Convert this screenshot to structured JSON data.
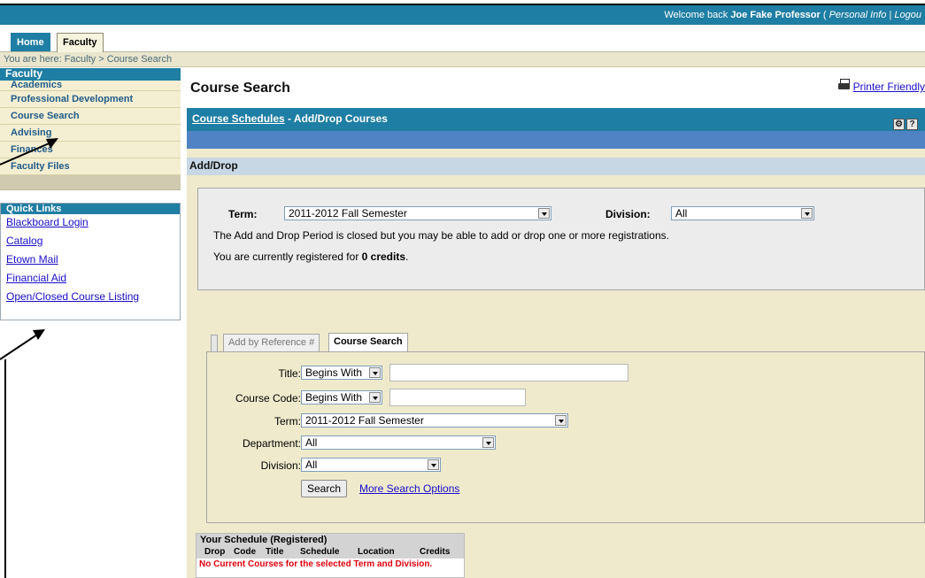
{
  "header": {
    "welcome_prefix": "Welcome back ",
    "user_name": "Joe Fake Professor",
    "paren_open": " ( ",
    "personal_info": "Personal Info",
    "separator": " | ",
    "logout": "Logou"
  },
  "tabs": [
    {
      "label": "Home",
      "active": false
    },
    {
      "label": "Faculty",
      "active": true
    }
  ],
  "breadcrumb": "You are here:  Faculty > Course Search",
  "sidebar": {
    "title": "Faculty",
    "items": [
      {
        "label": "Academics"
      },
      {
        "label": "Professional Development"
      },
      {
        "label": "Course Search"
      },
      {
        "label": "Advising"
      },
      {
        "label": "Finances"
      },
      {
        "label": "Faculty Files"
      }
    ]
  },
  "quick_links": {
    "title": "Quick Links",
    "items": [
      {
        "label": "Blackboard Login"
      },
      {
        "label": "Catalog"
      },
      {
        "label": "Etown Mail"
      },
      {
        "label": "Financial Aid"
      },
      {
        "label": "Open/Closed Course Listing"
      }
    ]
  },
  "main": {
    "title": "Course Search",
    "printer_friendly": "Printer Friendly",
    "panel_link": "Course Schedules",
    "panel_title": " - Add/Drop Courses",
    "panel_icons": [
      "wrench-icon",
      "help-icon"
    ],
    "help_glyph": "?",
    "section_title": "Add/Drop",
    "term_label": "Term:",
    "term_value": "2011-2012 Fall Semester",
    "division_label": "Division:",
    "division_value": "All",
    "message_closed": "The Add and Drop Period is closed but you may be able to add or drop one or more registrations.",
    "message_registered_prefix": "You are currently registered for ",
    "message_registered_credits": "0 credits",
    "message_registered_suffix": "."
  },
  "search_tabs": [
    {
      "label": "Add by Reference #",
      "active": false
    },
    {
      "label": "Course Search",
      "active": true
    }
  ],
  "search_form": {
    "title_label": "Title:",
    "title_mode": "Begins With",
    "code_label": "Course Code:",
    "code_mode": "Begins With",
    "term_label": "Term:",
    "term_value": "2011-2012 Fall Semester",
    "department_label": "Department:",
    "department_value": "All",
    "division_label": "Division:",
    "division_value": "All",
    "search_button": "Search",
    "more_options": "More Search Options"
  },
  "schedule": {
    "title": "Your Schedule (Registered)",
    "columns": [
      "Drop",
      "Code",
      "Title",
      "Schedule",
      "Location",
      "Credits"
    ],
    "empty_message": "No Current Courses for the selected Term and Division."
  },
  "colors": {
    "brand": "#1f7ea3",
    "panel_body": "#efeacc",
    "link": "#1a0dcc",
    "error": "#e0000c"
  }
}
